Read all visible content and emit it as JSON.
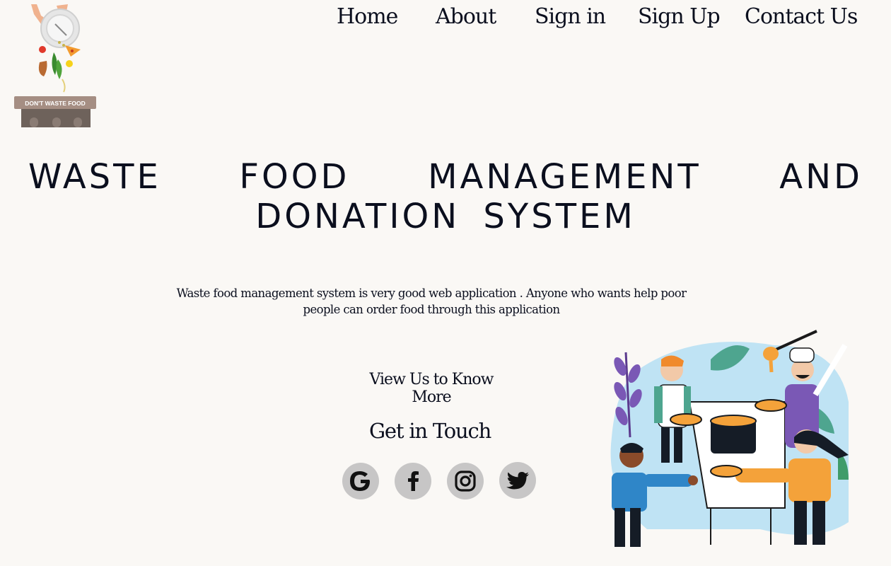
{
  "logo": {
    "alt_icon": "dont-waste-food-logo",
    "banner_text": "DON'T WASTE FOOD"
  },
  "nav": {
    "items": [
      {
        "label": "Home"
      },
      {
        "label": "About"
      },
      {
        "label": "Sign in"
      },
      {
        "label": "Sign Up"
      },
      {
        "label": "Contact Us"
      }
    ]
  },
  "hero": {
    "title": "WASTE FOOD MANAGEMENT AND DONATION SYSTEM",
    "description": "Waste food management system is very good web application . Anyone who wants help poor people can order food through this application"
  },
  "cta": {
    "view_more": "View Us to Know More"
  },
  "contact": {
    "heading": "Get in Touch",
    "socials": [
      {
        "icon": "google-icon"
      },
      {
        "icon": "facebook-icon"
      },
      {
        "icon": "instagram-icon"
      },
      {
        "icon": "twitter-icon"
      }
    ]
  },
  "colors": {
    "background": "#faf8f5",
    "text": "#0b0f1e",
    "social_bg": "#c7c6c6",
    "accent_orange": "#f4a23a",
    "accent_blue": "#bfe3f4"
  }
}
